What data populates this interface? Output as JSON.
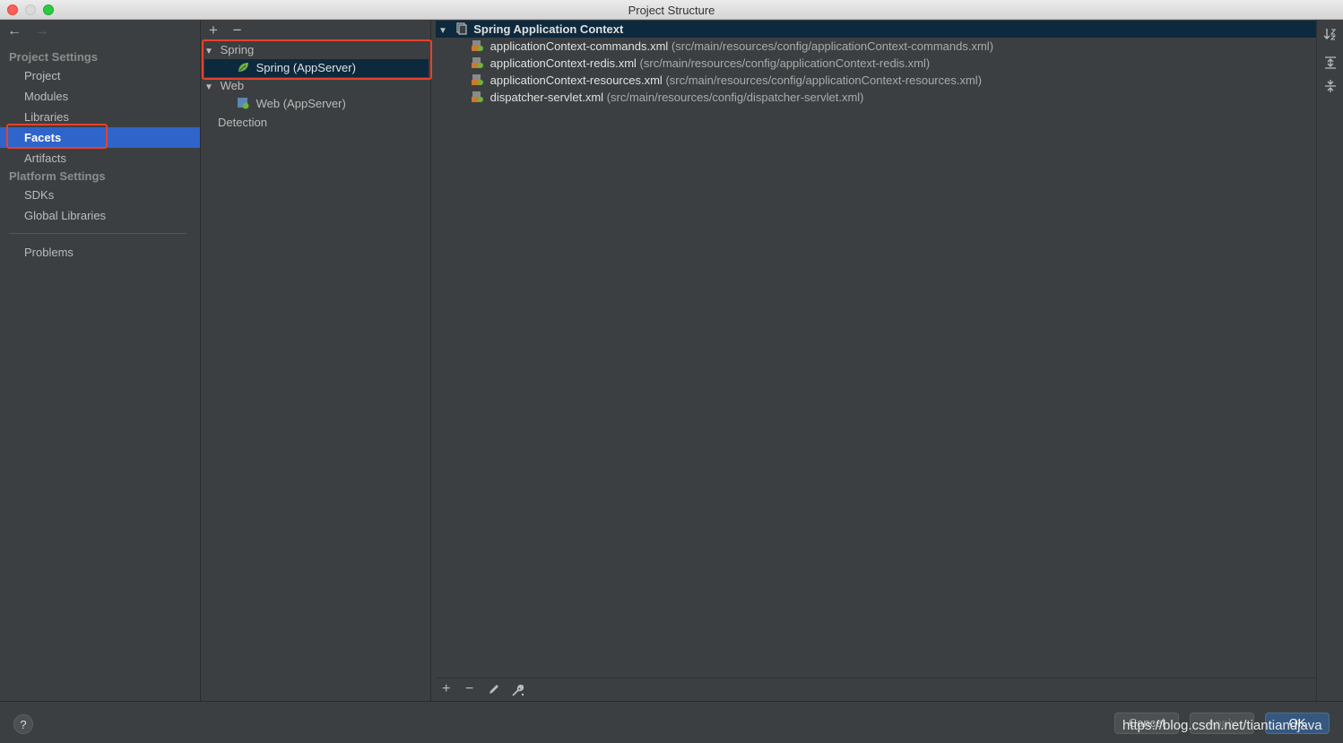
{
  "window": {
    "title": "Project Structure"
  },
  "nav": {
    "back": "←",
    "forward": "→"
  },
  "sidebar": {
    "project_settings_label": "Project Settings",
    "platform_settings_label": "Platform Settings",
    "items": [
      {
        "label": "Project"
      },
      {
        "label": "Modules"
      },
      {
        "label": "Libraries"
      },
      {
        "label": "Facets"
      },
      {
        "label": "Artifacts"
      },
      {
        "label": "SDKs"
      },
      {
        "label": "Global Libraries"
      },
      {
        "label": "Problems"
      }
    ],
    "selected": "Facets"
  },
  "facets_toolbar": {
    "add": "+",
    "remove": "−"
  },
  "facets_tree": {
    "spring_group": "Spring",
    "spring_item": "Spring (AppServer)",
    "web_group": "Web",
    "web_item": "Web (AppServer)",
    "detection": "Detection"
  },
  "context_panel": {
    "header": "Spring Application Context",
    "files": [
      {
        "name": "applicationContext-commands.xml",
        "path": "(src/main/resources/config/applicationContext-commands.xml)"
      },
      {
        "name": "applicationContext-redis.xml",
        "path": "(src/main/resources/config/applicationContext-redis.xml)"
      },
      {
        "name": "applicationContext-resources.xml",
        "path": "(src/main/resources/config/applicationContext-resources.xml)"
      },
      {
        "name": "dispatcher-servlet.xml",
        "path": "(src/main/resources/config/dispatcher-servlet.xml)"
      }
    ],
    "bottom_toolbar": {
      "add": "+",
      "remove": "−"
    }
  },
  "footer": {
    "help": "?",
    "cancel": "Cancel",
    "apply": "Apply",
    "ok": "OK",
    "watermark": "https://blog.csdn.net/tiantiandjava"
  },
  "colors": {
    "background": "#3c3f41",
    "selection": "#2f65ca",
    "tree_selection": "#0d293e",
    "highlight_box": "#e8412c",
    "spring_green": "#6db33f"
  }
}
